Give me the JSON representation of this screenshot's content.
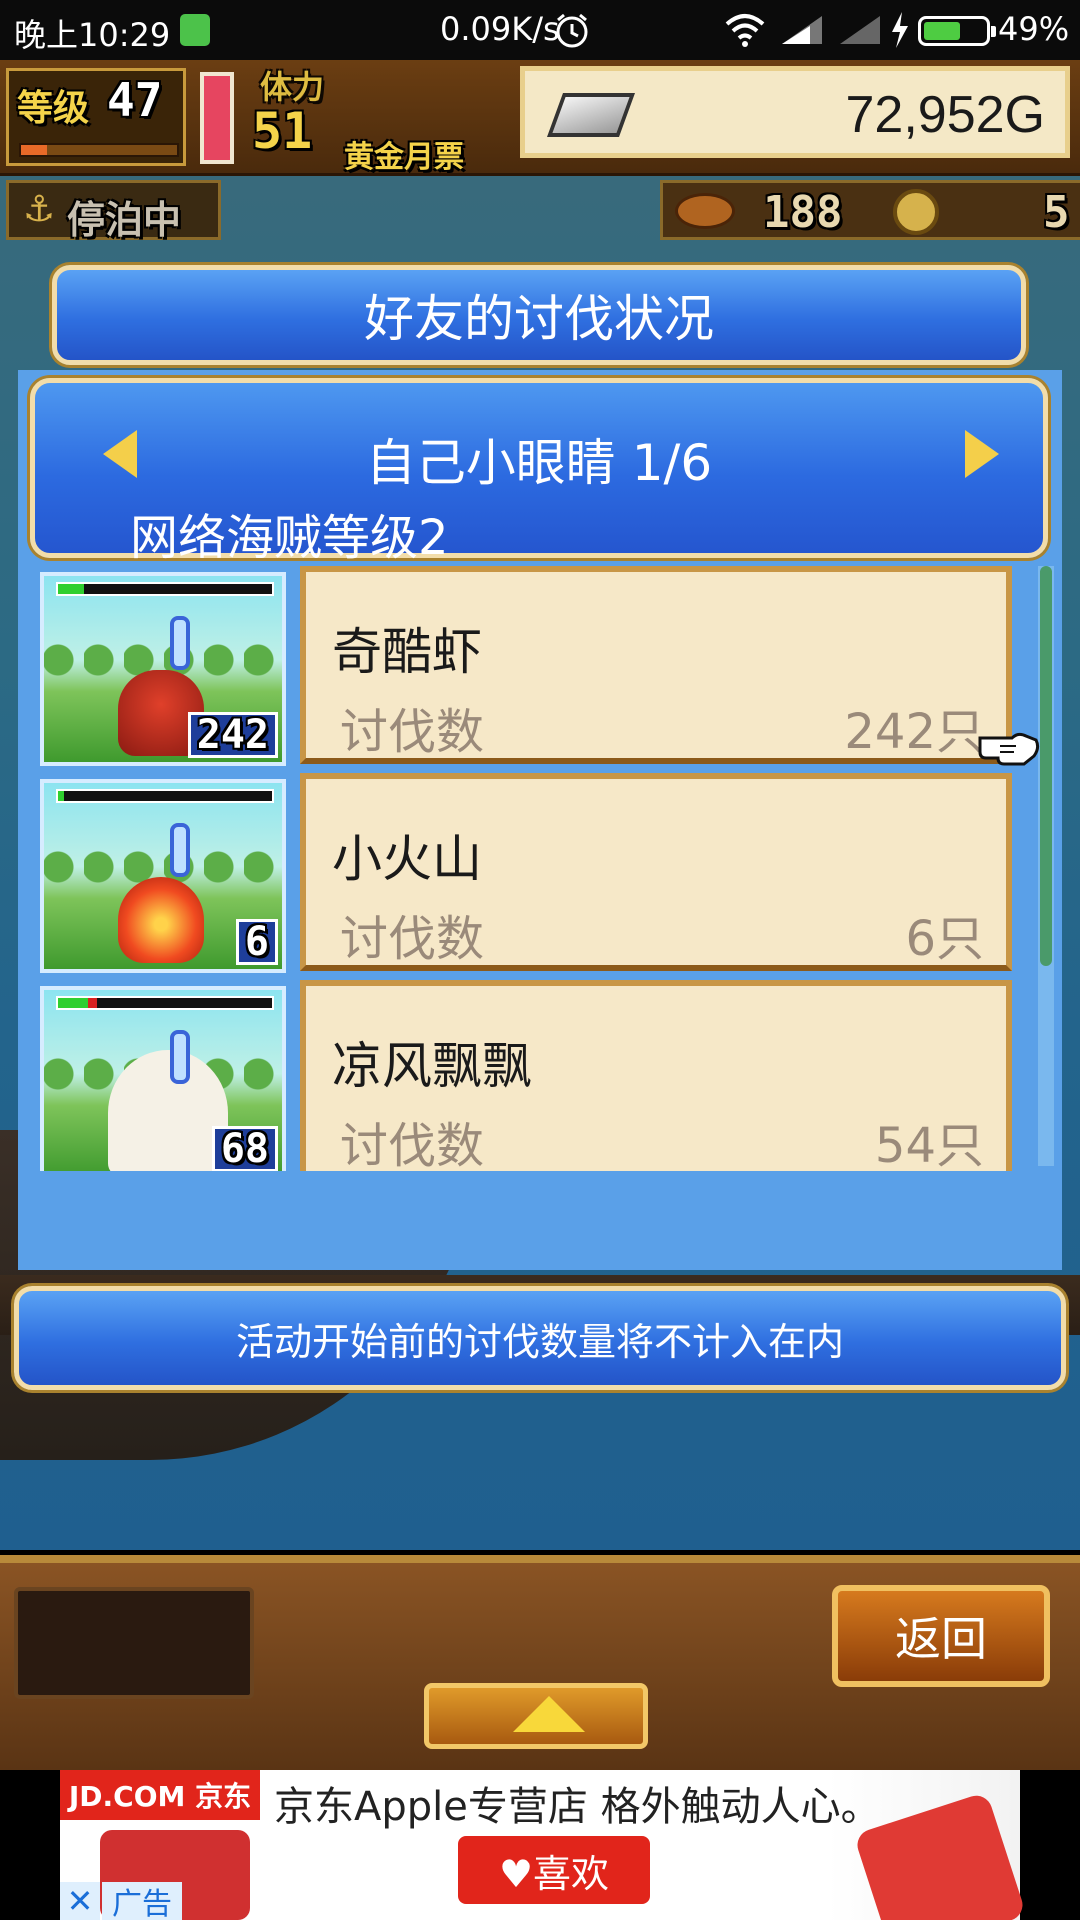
{
  "status_bar": {
    "time": "晚上10:29",
    "net_speed": "0.09K/s",
    "battery": "49%"
  },
  "hud": {
    "level_label": "等级",
    "level": "47",
    "stamina_label": "体力",
    "stamina": "51",
    "ticket_label": "黄金月票",
    "gold": "72,952G",
    "status": "停泊中",
    "food": "188",
    "coins": "5"
  },
  "dialog": {
    "title": "好友的讨伐状况",
    "player": "自己小眼睛 1/6",
    "pirate_level": "网络海贼等级2",
    "note": "活动开始前的讨伐数量将不计入在内",
    "kill_label": "讨伐数",
    "monsters": [
      {
        "name": "奇酷虾",
        "count": "242",
        "count_text": "242只",
        "hp_green": 0.12,
        "hp_red": 0
      },
      {
        "name": "小火山",
        "count": "6",
        "count_text": "6只",
        "hp_green": 0.03,
        "hp_red": 0
      },
      {
        "name": "凉风飘飘",
        "count": "68",
        "count_text": "54只",
        "hp_green": 0.14,
        "hp_red": 0.04
      }
    ]
  },
  "bottom": {
    "back_label": "返回"
  },
  "ad": {
    "brand": "JD.COM 京东",
    "title": "京东Apple专营店  格外触动人心。",
    "like_label": "♥喜欢",
    "tag": "广告",
    "close": "✕"
  },
  "colors": {
    "panel_blue": "#2f6fe0",
    "card_bg": "#f6e8c8",
    "ad_red": "#e1251b"
  }
}
